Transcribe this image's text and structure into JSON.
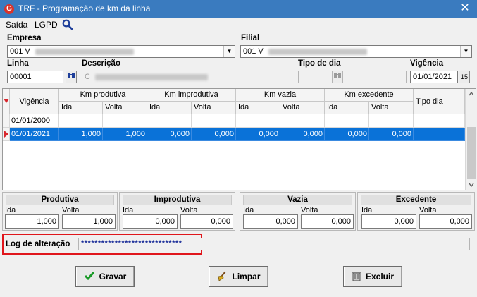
{
  "window": {
    "title": "TRF - Programação de km da linha",
    "close_glyph": "✕",
    "app_icon_letter": "G"
  },
  "menu": {
    "items": [
      "Saída",
      "LGPD"
    ]
  },
  "form": {
    "empresa_label": "Empresa",
    "empresa_value": "001 V",
    "filial_label": "Filial",
    "filial_value": "001 V",
    "linha_label": "Linha",
    "linha_value": "00001",
    "descricao_label": "Descrição",
    "descricao_value": "C",
    "tipo_dia_label": "Tipo de dia",
    "vigencia_label": "Vigência",
    "vigencia_value": "01/01/2021",
    "calendar_btn": "15"
  },
  "grid": {
    "headers": {
      "vigencia": "Vigência",
      "km_produtiva": "Km produtiva",
      "km_improdutiva": "Km improdutiva",
      "km_vazia": "Km vazia",
      "km_excedente": "Km excedente",
      "tipo_dia": "Tipo dia",
      "ida": "Ida",
      "volta": "Volta"
    },
    "rows": [
      {
        "vigencia": "01/01/2000",
        "values": [
          "",
          "",
          "",
          "",
          "",
          "",
          "",
          ""
        ]
      },
      {
        "vigencia": "01/01/2021",
        "values": [
          "1,000",
          "1,000",
          "0,000",
          "0,000",
          "0,000",
          "0,000",
          "0,000",
          "0,000"
        ]
      }
    ]
  },
  "groups": [
    {
      "title": "Produtiva",
      "ida_label": "Ida",
      "volta_label": "Volta",
      "ida": "1,000",
      "volta": "1,000"
    },
    {
      "title": "Improdutiva",
      "ida_label": "Ida",
      "volta_label": "Volta",
      "ida": "0,000",
      "volta": "0,000"
    },
    {
      "title": "Vazia",
      "ida_label": "Ida",
      "volta_label": "Volta",
      "ida": "0,000",
      "volta": "0,000"
    },
    {
      "title": "Excedente",
      "ida_label": "Ida",
      "volta_label": "Volta",
      "ida": "0,000",
      "volta": "0,000"
    }
  ],
  "log": {
    "label": "Log de alteração",
    "value": "******************************"
  },
  "buttons": {
    "gravar": "Gravar",
    "limpar": "Limpar",
    "excluir": "Excluir"
  },
  "colors": {
    "titlebar": "#3a7bbf",
    "selected_row": "#0a72d8",
    "highlight_border": "#e0161c",
    "ok_green": "#1a9a28"
  }
}
